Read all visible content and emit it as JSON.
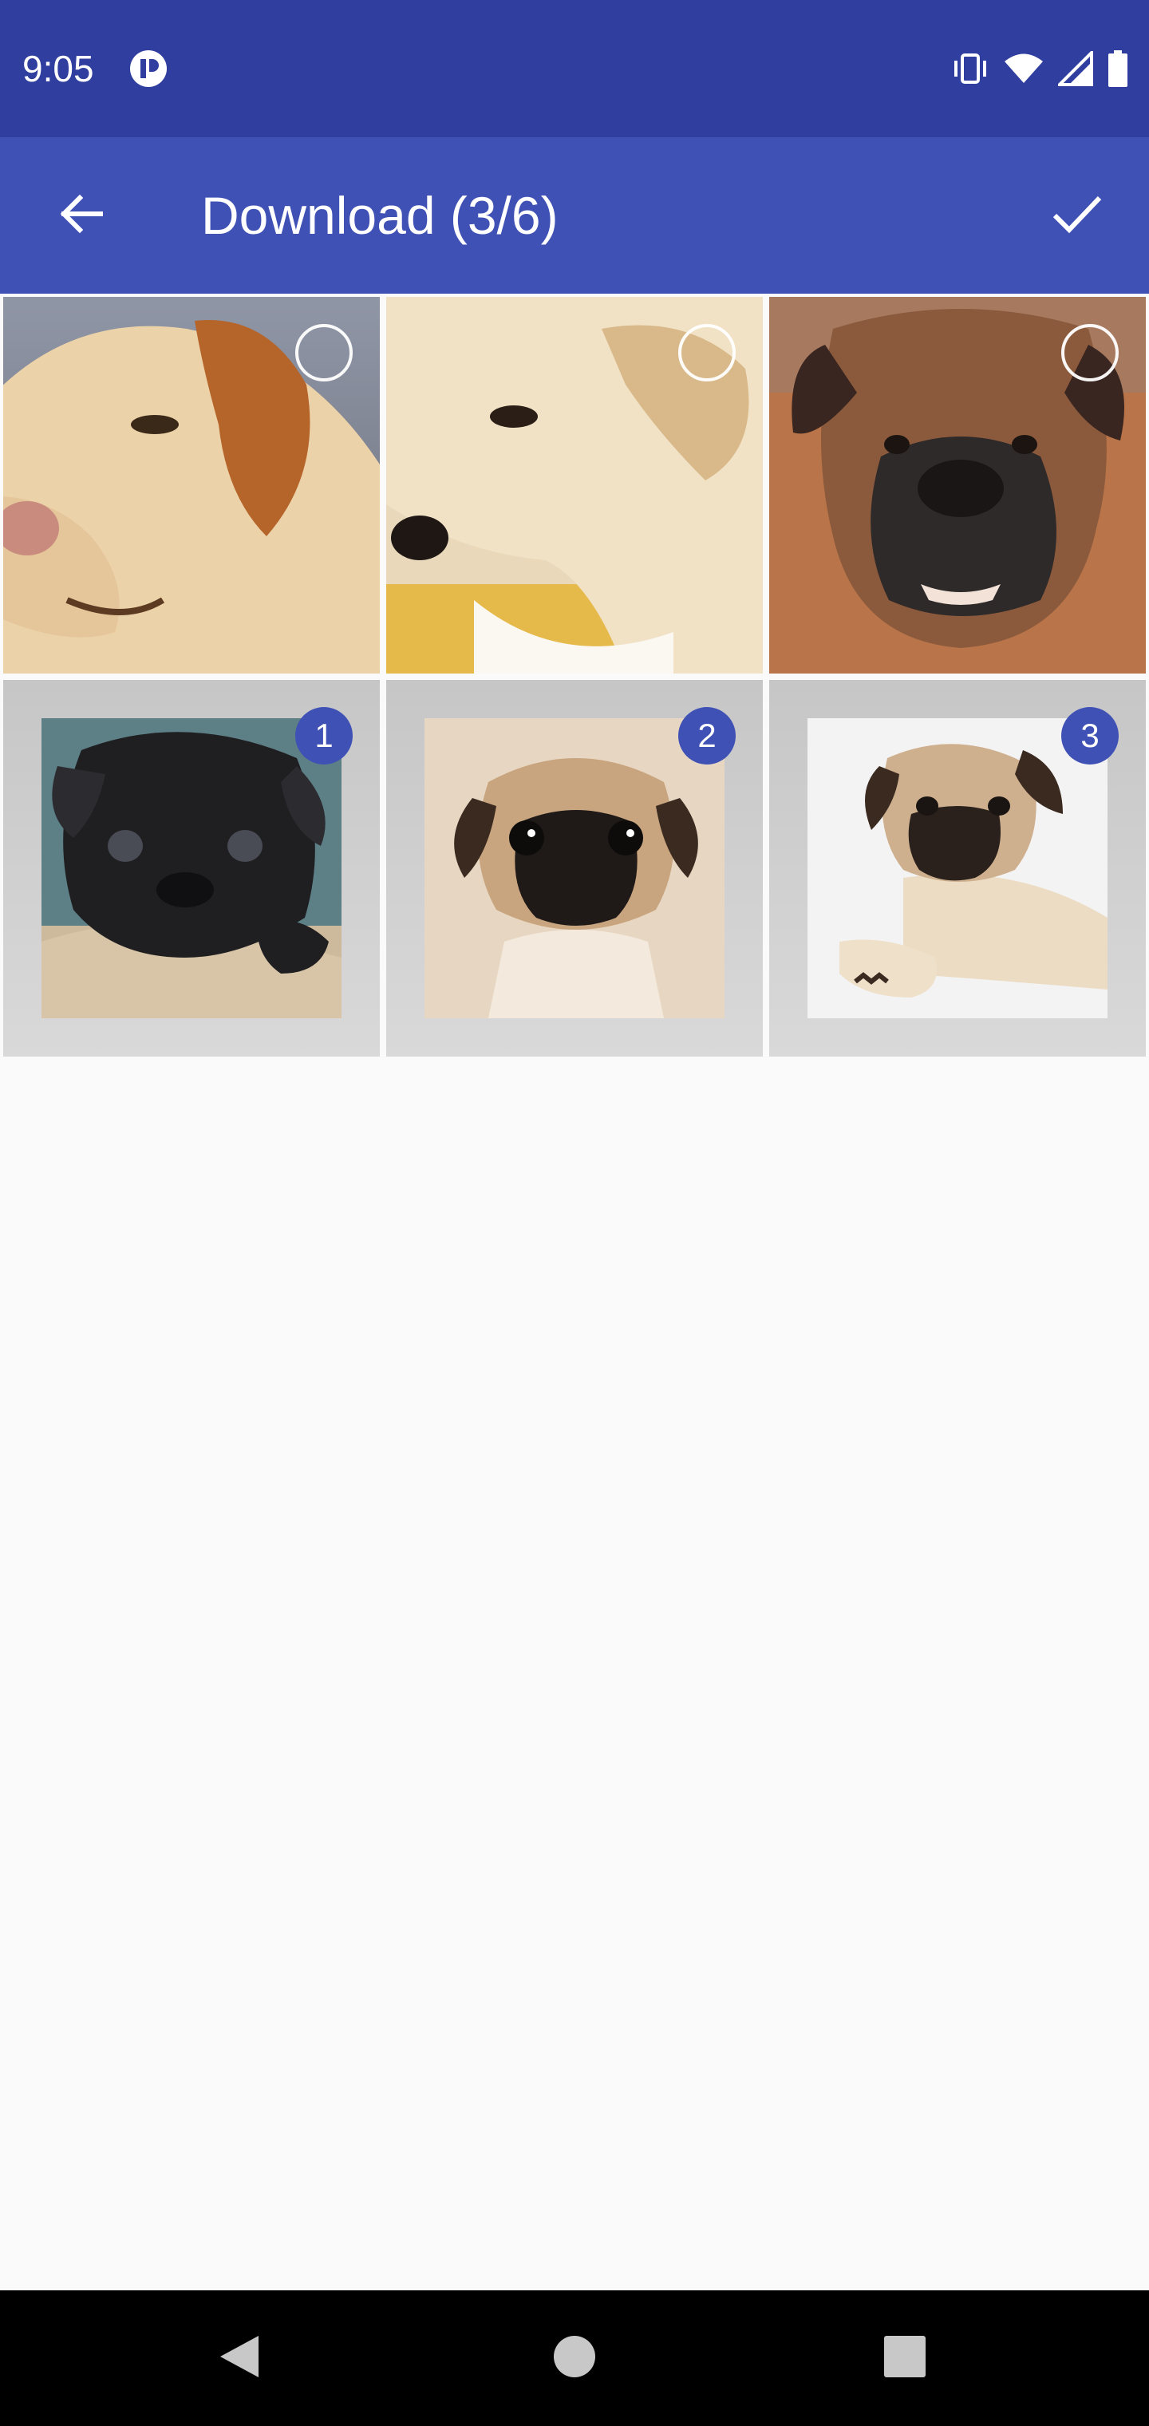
{
  "status_bar": {
    "time": "9:05",
    "icons": [
      "notification-icon",
      "vibrate-icon",
      "wifi-icon",
      "signal-icon",
      "battery-icon"
    ]
  },
  "app_bar": {
    "title": "Download (3/6)",
    "back_icon": "arrow-back-icon",
    "confirm_icon": "check-icon",
    "color": "#3f51b5",
    "status_color": "#303f9f"
  },
  "images": [
    {
      "subject": "labrador",
      "selected": false,
      "order": ""
    },
    {
      "subject": "golden-puppy",
      "selected": false,
      "order": ""
    },
    {
      "subject": "boxer",
      "selected": false,
      "order": ""
    },
    {
      "subject": "black-pug",
      "selected": true,
      "order": "1"
    },
    {
      "subject": "fawn-pug-puppy",
      "selected": true,
      "order": "2"
    },
    {
      "subject": "fawn-pug-lying",
      "selected": true,
      "order": "3"
    }
  ],
  "nav_bar": {
    "icons": [
      "back-triangle-icon",
      "home-circle-icon",
      "recents-square-icon"
    ]
  }
}
